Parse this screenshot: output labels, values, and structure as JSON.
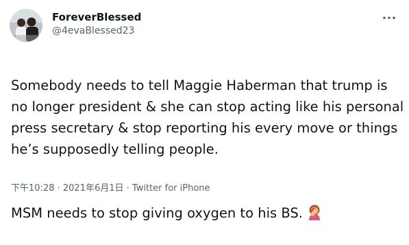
{
  "user": {
    "display_name": "ForeverBlessed",
    "handle": "@4evaBlessed23"
  },
  "tweet": {
    "paragraph_1": "Somebody needs to tell Maggie Haberman that trump is no longer president & she can stop acting like his personal press secretary & stop reporting his every move or things he’s supposedly telling people.",
    "paragraph_2": "MSM needs to stop giving oxygen to his BS.",
    "emoji": "woman-facepalming-emoji"
  },
  "meta": {
    "time": "下午10:28",
    "separator_1": " · ",
    "date": "2021年6月1日",
    "separator_2": " · ",
    "source": "Twitter for iPhone"
  },
  "icons": {
    "more": "more-horizontal-icon"
  },
  "colors": {
    "text_primary": "#0f1419",
    "text_secondary": "#536471",
    "background": "#ffffff"
  }
}
